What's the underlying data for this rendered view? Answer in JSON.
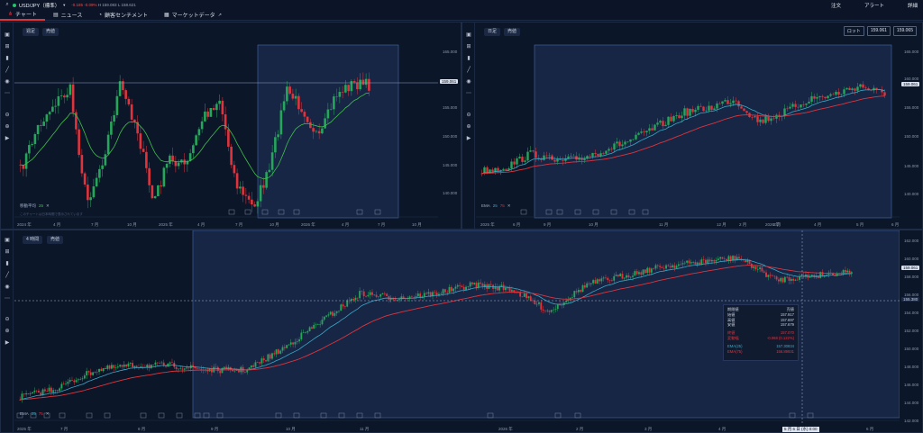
{
  "topbar": {
    "symbol": "USD/JPY（標準）",
    "change": "-0.185",
    "change_pct": "-0.09%",
    "high_label": "H",
    "high": "159.083",
    "low_label": "L",
    "low": "158.621",
    "menu": [
      "注文",
      "アラート",
      "詳細"
    ]
  },
  "tabs": [
    "チャート",
    "ニュース",
    "顧客センチメント",
    "マーケットデータ"
  ],
  "panels": {
    "weekly": {
      "timeframe": "週足",
      "mode": "売値",
      "indicator": "移動平均",
      "period": "25",
      "note": "このチャートは日本時間で表示されています",
      "x_ticks": [
        "2024 年",
        "4 月",
        "7 月",
        "10 月",
        "2025 年",
        "4 月",
        "7 月",
        "10 月",
        "2026 年",
        "4 月",
        "7 月",
        "10 月"
      ],
      "y_ticks": [
        "165.000",
        "160.000",
        "155.000",
        "150.000",
        "145.000",
        "140.000"
      ],
      "price": "159.061"
    },
    "daily": {
      "timeframe": "日足",
      "mode": "売値",
      "indicator": "EMA",
      "p1": "25",
      "p2": "75",
      "x_ticks": [
        "2025 年",
        "6 月",
        "9 月",
        "10 月",
        "11 月",
        "12 月",
        "2026 年",
        "2 月",
        "3 月",
        "4 月",
        "5 月",
        "6 月"
      ],
      "y_ticks": [
        "165.000",
        "160.000",
        "155.000",
        "150.000",
        "145.000",
        "140.000"
      ],
      "price": "159.061",
      "quote_label": "ロット",
      "bid": "159.061",
      "ask": "159.065"
    },
    "h4": {
      "timeframe": "4 時間",
      "mode": "売値",
      "indicator": "EMA",
      "p1": "25",
      "p2": "75",
      "x_ticks": [
        "2025 年",
        "7 月",
        "8 月",
        "9 月",
        "10 月",
        "11 月",
        "2026 年",
        "2 月",
        "3 月",
        "4 月",
        "5 月",
        "6 月"
      ],
      "y_ticks": [
        "162.000",
        "160.000",
        "158.000",
        "156.000",
        "154.000",
        "152.000",
        "150.000",
        "148.000",
        "146.000",
        "144.000",
        "142.000"
      ],
      "price": "159.061",
      "cross_price": "155.380",
      "cross_date": "5 月 6 日 (水) 0:00",
      "tooltip": {
        "rows": [
          [
            "始値",
            "157.917"
          ],
          [
            "高値",
            "157.697"
          ],
          [
            "安値",
            "157.679"
          ],
          [
            "終値",
            "157.070"
          ],
          [
            "変動幅",
            "-0.068 (0.122%)"
          ],
          [
            "EMA(25)",
            "157.30834"
          ],
          [
            "EMA(75)",
            "156.89931"
          ]
        ],
        "header": [
          "期間値",
          "売値"
        ]
      }
    }
  }
}
